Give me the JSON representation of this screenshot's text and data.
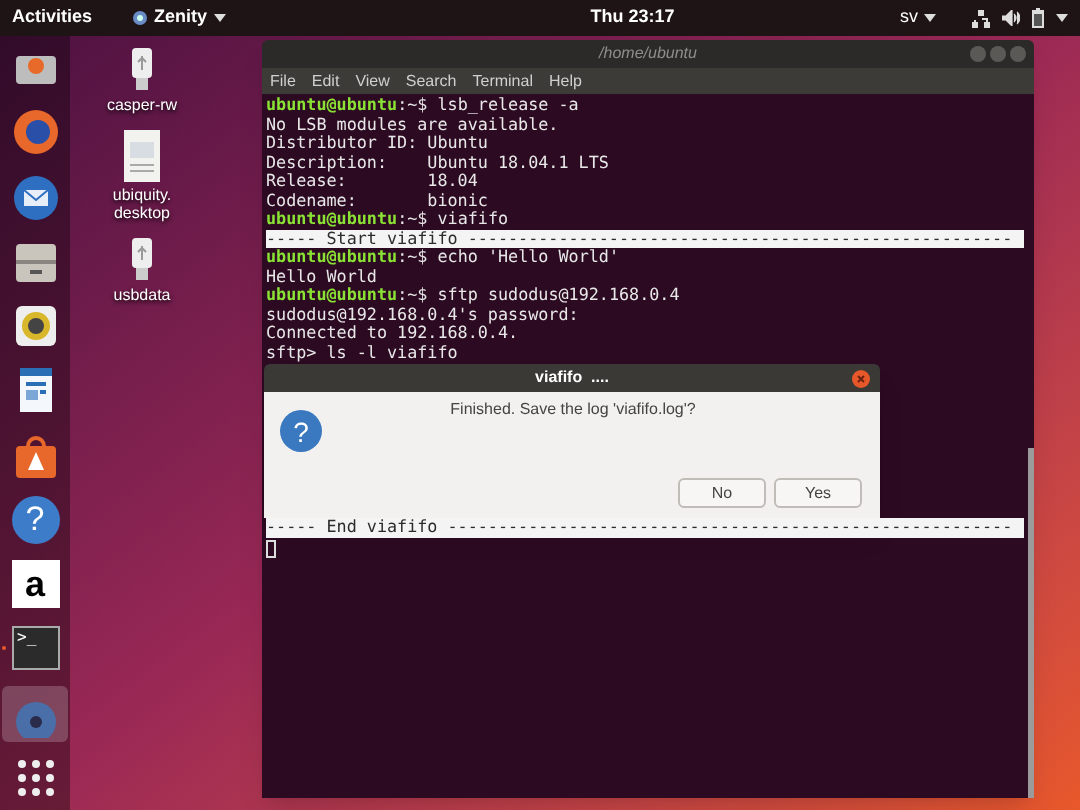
{
  "top_bar": {
    "activities": "Activities",
    "app_menu": "Zenity",
    "clock": "Thu 23:17",
    "language": "sv"
  },
  "dock": {
    "items": [
      {
        "kind": "drive",
        "running": false,
        "highlighted": false
      },
      {
        "kind": "browser",
        "running": false,
        "highlighted": false
      },
      {
        "kind": "mail",
        "running": false,
        "highlighted": false
      },
      {
        "kind": "cabinet",
        "running": false,
        "highlighted": false
      },
      {
        "kind": "speaker",
        "running": false,
        "highlighted": false
      },
      {
        "kind": "document",
        "running": false,
        "highlighted": false
      },
      {
        "kind": "bag",
        "running": false,
        "highlighted": false
      },
      {
        "kind": "help",
        "glyph": "?",
        "running": false,
        "highlighted": false
      },
      {
        "kind": "store",
        "glyph": "a",
        "running": false,
        "highlighted": false
      },
      {
        "kind": "terminal",
        "glyph": ">_",
        "running": true,
        "highlighted": false
      },
      {
        "kind": "disc",
        "running": false,
        "highlighted": true
      },
      {
        "kind": "grid",
        "running": false,
        "highlighted": false
      }
    ]
  },
  "desktop_icons": [
    {
      "kind": "usb",
      "label": "casper-rw"
    },
    {
      "kind": "file",
      "label": "ubiquity.desktop"
    },
    {
      "kind": "usb",
      "label": "usbdata"
    }
  ],
  "terminal": {
    "title": "/home/ubuntu",
    "menu": [
      "File",
      "Edit",
      "View",
      "Search",
      "Terminal",
      "Help"
    ],
    "lines_before": [
      {
        "kind": "prompt",
        "user": "ubuntu@ubuntu",
        "text": ":~$ lsb_release -a"
      },
      {
        "kind": "output",
        "text": "No LSB modules are available."
      },
      {
        "kind": "output",
        "text": "Distributor ID: Ubuntu"
      },
      {
        "kind": "output",
        "text": "Description:    Ubuntu 18.04.1 LTS"
      },
      {
        "kind": "output",
        "text": "Release:        18.04"
      },
      {
        "kind": "output",
        "text": "Codename:       bionic"
      },
      {
        "kind": "prompt",
        "user": "ubuntu@ubuntu",
        "text": ":~$ viafifo"
      },
      {
        "kind": "banner",
        "text": "----- Start viafifo ------------------------------------------------------"
      },
      {
        "kind": "prompt",
        "user": "ubuntu@ubuntu",
        "text": ":~$ echo 'Hello World'"
      },
      {
        "kind": "output",
        "text": "Hello World"
      },
      {
        "kind": "prompt",
        "user": "ubuntu@ubuntu",
        "text": ":~$ sftp sudodus@192.168.0.4"
      },
      {
        "kind": "output",
        "text": "sudodus@192.168.0.4's password:"
      },
      {
        "kind": "output",
        "text": "Connected to 192.168.0.4."
      },
      {
        "kind": "output",
        "text": "sftp> ls -l viafifo"
      }
    ],
    "lines_after": [
      {
        "kind": "banner",
        "text": "----- End viafifo --------------------------------------------------------"
      }
    ],
    "cursor_visible": true
  },
  "dialog": {
    "title": "viafifo  ....",
    "glyph": "?",
    "message": "Finished. Save the log 'viafifo.log'?",
    "buttons": [
      "No",
      "Yes"
    ]
  }
}
